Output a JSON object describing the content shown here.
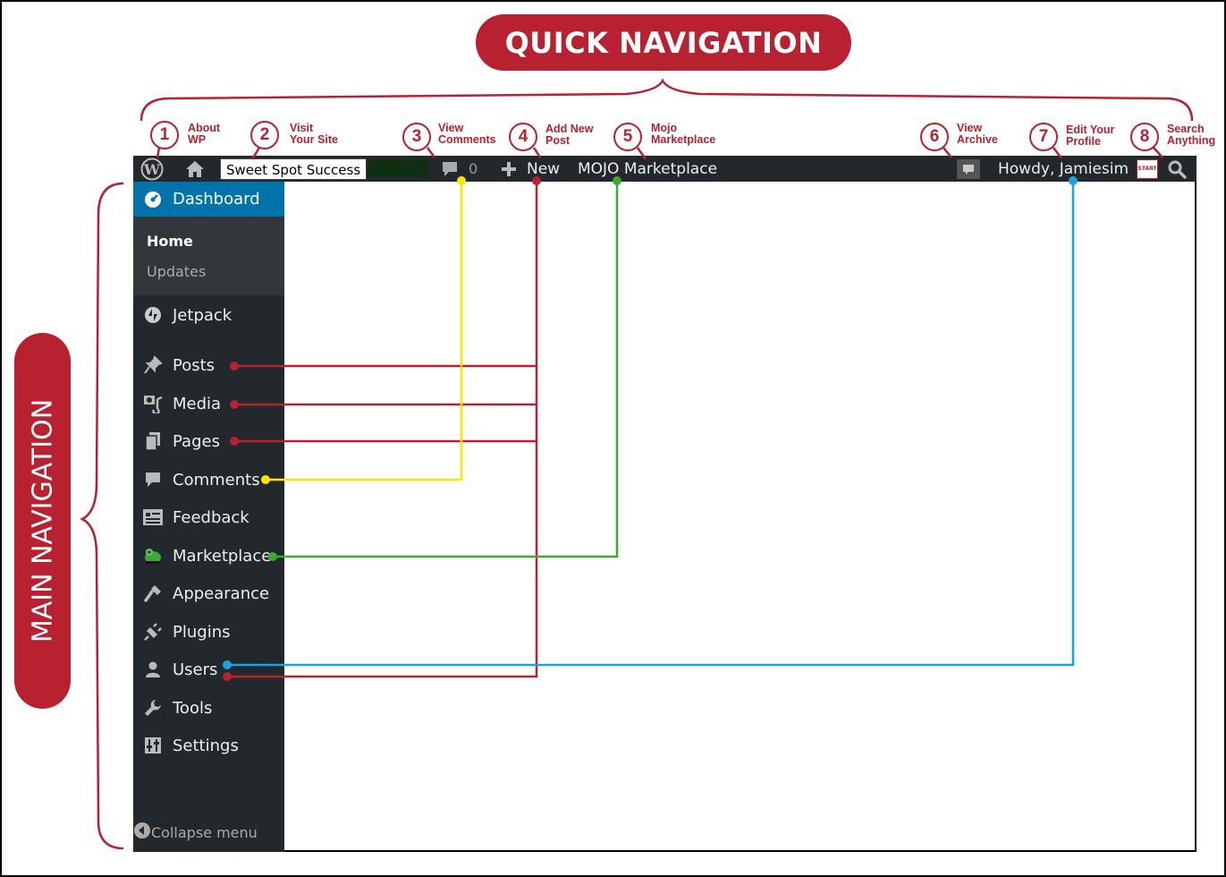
{
  "titles": {
    "quick": "QUICK NAVIGATION",
    "main": "MAIN NAVIGATION"
  },
  "callouts": [
    {
      "num": "1",
      "line1": "About",
      "line2": "WP"
    },
    {
      "num": "2",
      "line1": "Visit",
      "line2": "Your Site"
    },
    {
      "num": "3",
      "line1": "View",
      "line2": "Comments"
    },
    {
      "num": "4",
      "line1": "Add New",
      "line2": "Post"
    },
    {
      "num": "5",
      "line1": "Mojo",
      "line2": "Marketplace"
    },
    {
      "num": "6",
      "line1": "View",
      "line2": "Archive"
    },
    {
      "num": "7",
      "line1": "Edit Your",
      "line2": "Profile"
    },
    {
      "num": "8",
      "line1": "Search",
      "line2": "Anything"
    }
  ],
  "admin_bar": {
    "site_name": "Sweet Spot Success",
    "comment_count": "0",
    "new_label": "New",
    "mojo_label": "MOJO Marketplace",
    "howdy": "Howdy, Jamiesim",
    "avatar_text": "START"
  },
  "sidebar": {
    "dashboard": "Dashboard",
    "submenu": [
      "Home",
      "Updates"
    ],
    "items": [
      "Jetpack",
      "Posts",
      "Media",
      "Pages",
      "Comments",
      "Feedback",
      "Marketplace",
      "Appearance",
      "Plugins",
      "Users",
      "Tools",
      "Settings"
    ],
    "collapse": "Collapse menu"
  },
  "colors": {
    "accent_red": "#b8212f",
    "admin_bar": "#23282d",
    "dashboard_blue": "#0073aa",
    "connector_yellow": "#ffe600",
    "connector_green": "#3aaa35",
    "connector_blue": "#1aa3e0"
  }
}
